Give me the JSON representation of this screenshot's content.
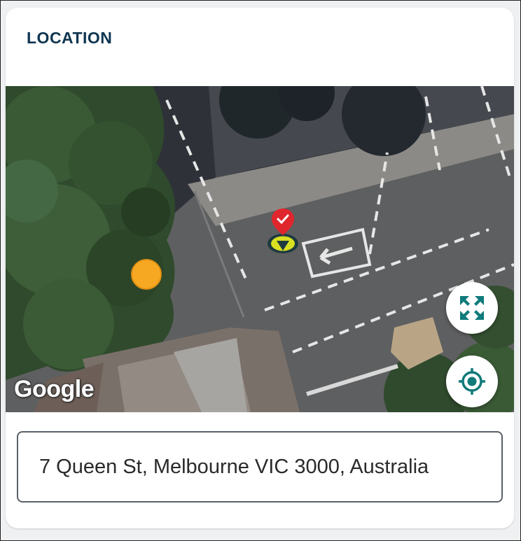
{
  "location_card": {
    "title": "LOCATION",
    "map": {
      "provider_logo": "Google",
      "view": "satellite",
      "controls": [
        {
          "name": "expand-map",
          "icon": "expand-arrows-icon",
          "color": "#117a7a"
        },
        {
          "name": "my-location",
          "icon": "crosshair-target-icon",
          "color": "#117a7a"
        }
      ],
      "markers": [
        {
          "name": "selected-location",
          "icon": "red-pin-with-check-icon",
          "color": "#e0262d"
        },
        {
          "name": "current-position",
          "icon": "orange-dot",
          "color": "#f7a823"
        }
      ]
    },
    "address": "7 Queen St, Melbourne VIC 3000, Australia"
  }
}
